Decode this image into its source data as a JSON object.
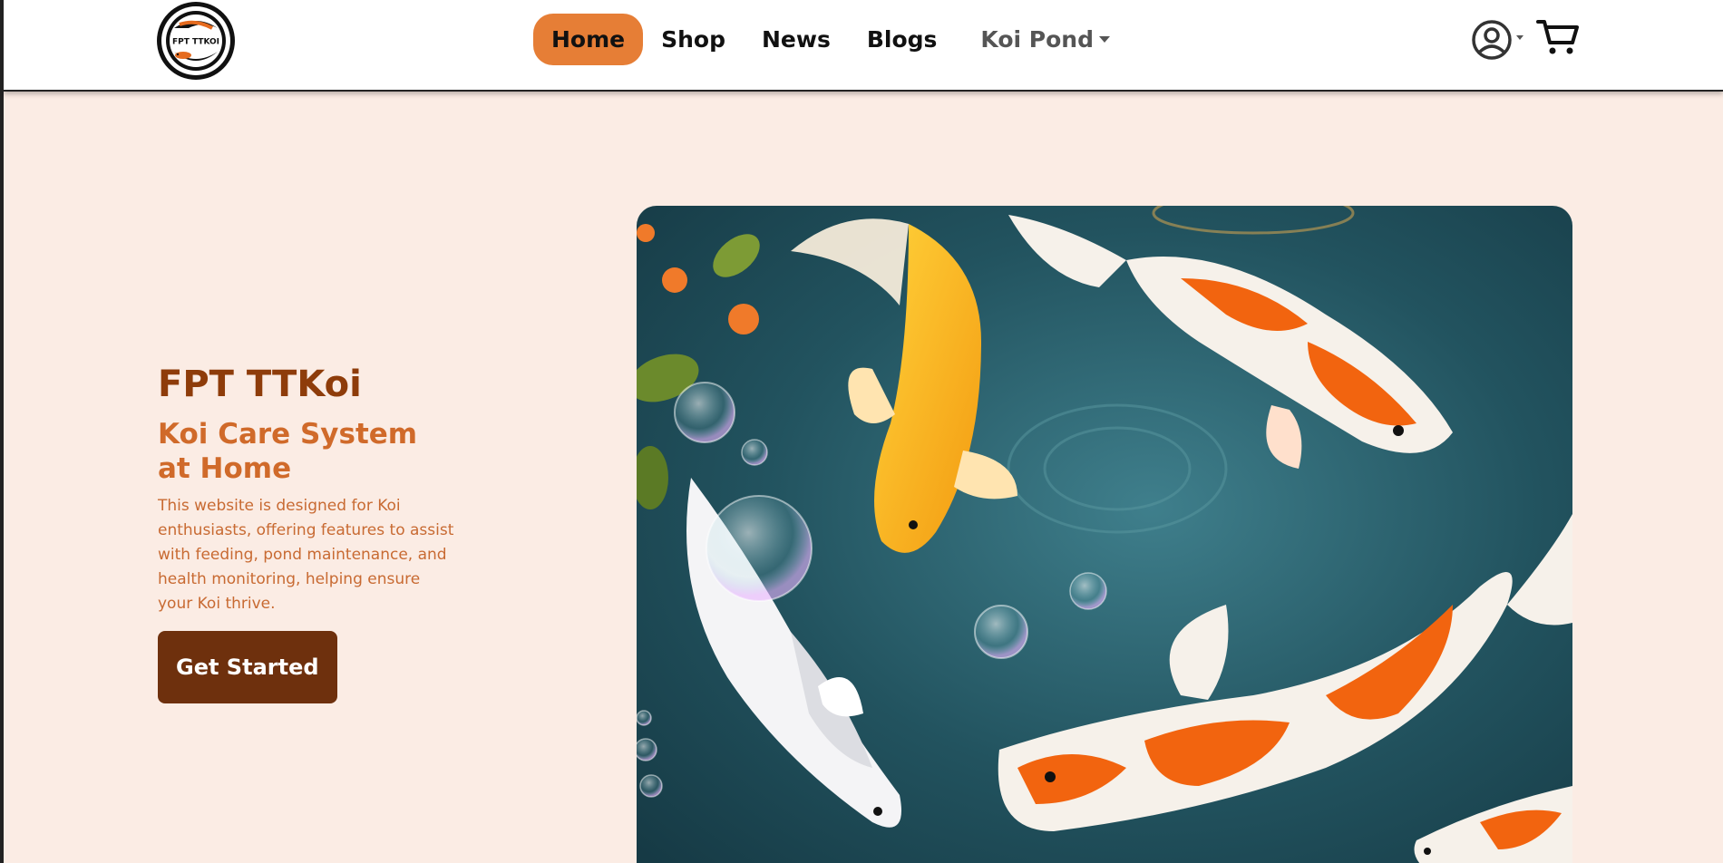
{
  "brand": {
    "logo_text": "FPT TTKOI",
    "logo_alt": "FPT TTKoi logo"
  },
  "nav": {
    "items": [
      {
        "label": "Home",
        "active": true
      },
      {
        "label": "Shop"
      },
      {
        "label": "News"
      },
      {
        "label": "Blogs"
      }
    ],
    "dropdown_label": "Koi Pond"
  },
  "icons": {
    "user": "user-circle-icon",
    "cart": "shopping-cart-icon"
  },
  "hero": {
    "title": "FPT TTKoi",
    "subtitle": "Koi Care System at Home",
    "description": "This website is designed for Koi enthusiasts, offering features to assist with feeding, pond maintenance, and health monitoring, helping ensure your Koi thrive.",
    "cta_label": "Get Started"
  },
  "colors": {
    "accent": "#e67e36",
    "hero_bg": "#fbece4",
    "title": "#8e3c0a",
    "subtitle": "#d06a2a",
    "cta_bg": "#6e300d"
  }
}
